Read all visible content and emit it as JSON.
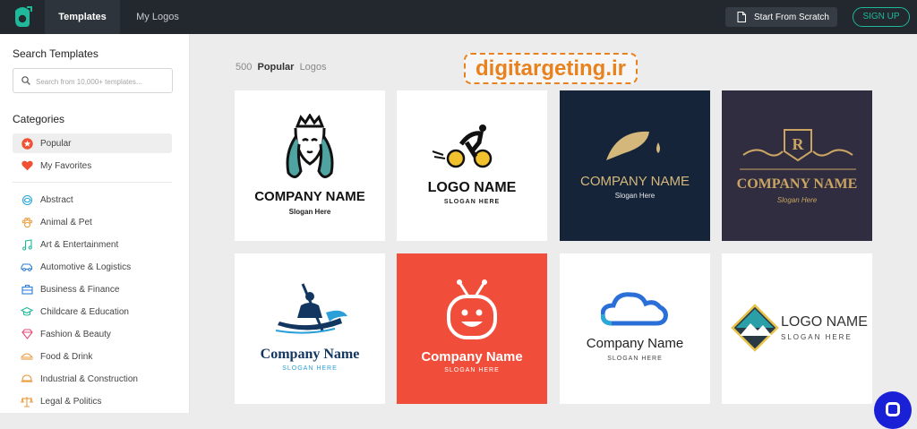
{
  "topbar": {
    "tabs": [
      {
        "label": "Templates",
        "active": true
      },
      {
        "label": "My Logos",
        "active": false
      }
    ],
    "scratch_label": "Start From Scratch",
    "signup_label": "SIGN UP"
  },
  "sidebar": {
    "search_title": "Search Templates",
    "search_placeholder": "Search from 10,000+ templates...",
    "categories_title": "Categories",
    "pinned": [
      {
        "label": "Popular",
        "icon": "star-icon",
        "active": true
      },
      {
        "label": "My Favorites",
        "icon": "heart-icon",
        "active": false
      }
    ],
    "categories": [
      {
        "label": "Abstract",
        "icon": "abstract-icon"
      },
      {
        "label": "Animal & Pet",
        "icon": "paw-icon"
      },
      {
        "label": "Art & Entertainment",
        "icon": "music-icon"
      },
      {
        "label": "Automotive & Logistics",
        "icon": "car-icon"
      },
      {
        "label": "Business & Finance",
        "icon": "briefcase-icon"
      },
      {
        "label": "Childcare & Education",
        "icon": "graduation-cap-icon"
      },
      {
        "label": "Fashion & Beauty",
        "icon": "diamond-icon"
      },
      {
        "label": "Food & Drink",
        "icon": "food-icon"
      },
      {
        "label": "Industrial & Construction",
        "icon": "helmet-icon"
      },
      {
        "label": "Legal & Politics",
        "icon": "scales-icon"
      }
    ]
  },
  "main": {
    "count": "500",
    "count_strong": "Popular",
    "count_suffix": "Logos",
    "watermark": "digitargeting.ir"
  },
  "cards": [
    {
      "name": "COMPANY NAME",
      "slogan": "Slogan Here",
      "bg": "#ffffff",
      "icon": "queen-icon"
    },
    {
      "name": "LOGO NAME",
      "slogan": "SLOGAN HERE",
      "bg": "#ffffff",
      "icon": "cyclist-icon"
    },
    {
      "name": "COMPANY NAME",
      "slogan": "Slogan Here",
      "bg": "#16243a",
      "icon": "feather-icon"
    },
    {
      "name": "COMPANY NAME",
      "slogan": "Slogan Here",
      "bg": "#2f2d3f",
      "icon": "crest-icon"
    },
    {
      "name": "Company Name",
      "slogan": "SLOGAN HERE",
      "bg": "#ffffff",
      "icon": "kayak-icon"
    },
    {
      "name": "Company Name",
      "slogan": "SLOGAN HERE",
      "bg": "#f04e3a",
      "icon": "tv-face-icon"
    },
    {
      "name": "Company Name",
      "slogan": "SLOGAN HERE",
      "bg": "#ffffff",
      "icon": "cloud-icon"
    },
    {
      "name": "LOGO NAME",
      "slogan": "SLOGAN HERE",
      "bg": "#ffffff",
      "icon": "mountain-icon"
    }
  ],
  "colors": {
    "accent": "#1fb89a",
    "topbar": "#23282e",
    "watermark": "#e8821e",
    "help": "#1a20d6"
  }
}
